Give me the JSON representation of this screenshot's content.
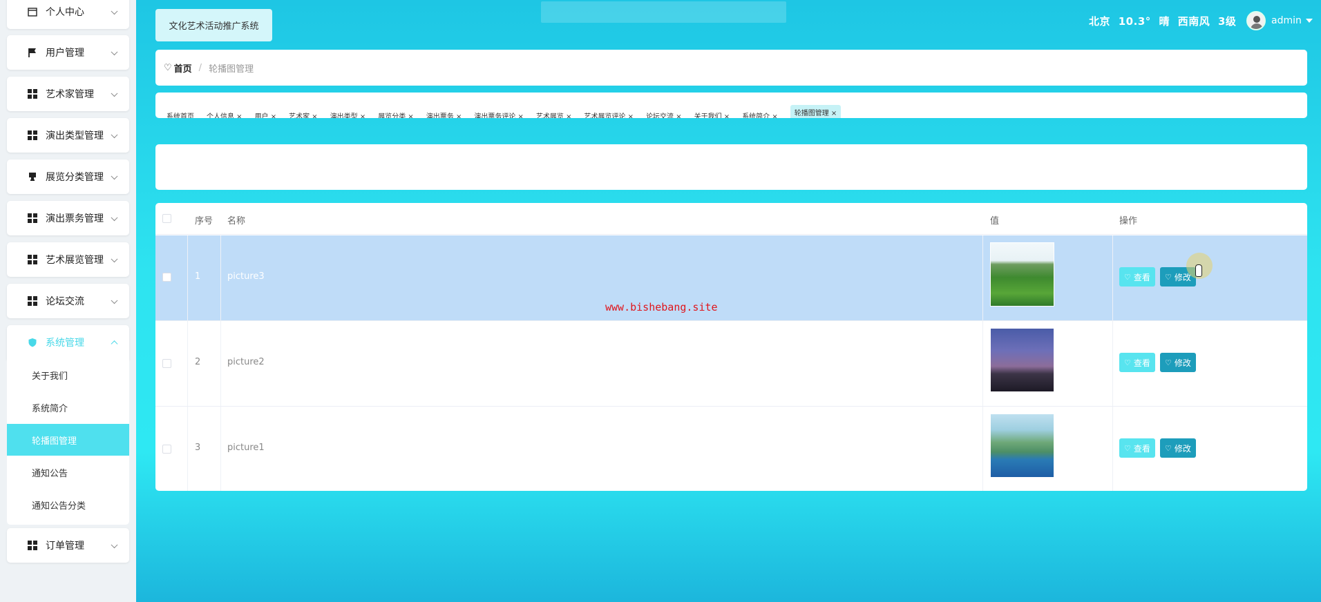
{
  "sidebar": {
    "items": [
      {
        "label": "个人中心",
        "icon": "calendar-icon"
      },
      {
        "label": "用户管理",
        "icon": "flag-icon"
      },
      {
        "label": "艺术家管理",
        "icon": "grid-icon"
      },
      {
        "label": "演出类型管理",
        "icon": "grid-icon"
      },
      {
        "label": "展览分类管理",
        "icon": "stamp-icon"
      },
      {
        "label": "演出票务管理",
        "icon": "grid-icon"
      },
      {
        "label": "艺术展览管理",
        "icon": "grid-icon"
      },
      {
        "label": "论坛交流",
        "icon": "grid-icon"
      },
      {
        "label": "系统管理",
        "icon": "shield-icon"
      },
      {
        "label": "订单管理",
        "icon": "grid-icon"
      }
    ],
    "system_submenu": [
      {
        "label": "关于我们"
      },
      {
        "label": "系统简介"
      },
      {
        "label": "轮播图管理"
      },
      {
        "label": "通知公告"
      },
      {
        "label": "通知公告分类"
      }
    ]
  },
  "header": {
    "system_title": "文化艺术活动推广系统",
    "weather": {
      "city": "北京",
      "temp": "10.3°",
      "condition": "晴",
      "wind": "西南风",
      "level": "3级"
    },
    "username": "admin"
  },
  "breadcrumb": {
    "home": "首页",
    "current": "轮播图管理"
  },
  "tags": [
    "系统首页",
    "个人信息 ×",
    "用户 ×",
    "艺术家 ×",
    "演出类型 ×",
    "展览分类 ×",
    "演出票务 ×",
    "演出票务评论 ×",
    "艺术展览 ×",
    "艺术展览评论 ×",
    "论坛交流 ×",
    "关于我们 ×",
    "系统简介 ×",
    "轮播图管理 ×"
  ],
  "table": {
    "headers": {
      "index": "序号",
      "name": "名称",
      "value": "值",
      "actions": "操作"
    },
    "rows": [
      {
        "index": "1",
        "name": "picture3"
      },
      {
        "index": "2",
        "name": "picture2"
      },
      {
        "index": "3",
        "name": "picture1"
      }
    ],
    "view_label": "查看",
    "edit_label": "修改"
  },
  "watermark": "www.bishebang.site",
  "colors": {
    "accent": "#4fe0ee",
    "edit_button": "#1d9dbb",
    "view_button": "#58e4ef",
    "selected_row": "#bfdcf8",
    "watermark": "#e0161c"
  }
}
